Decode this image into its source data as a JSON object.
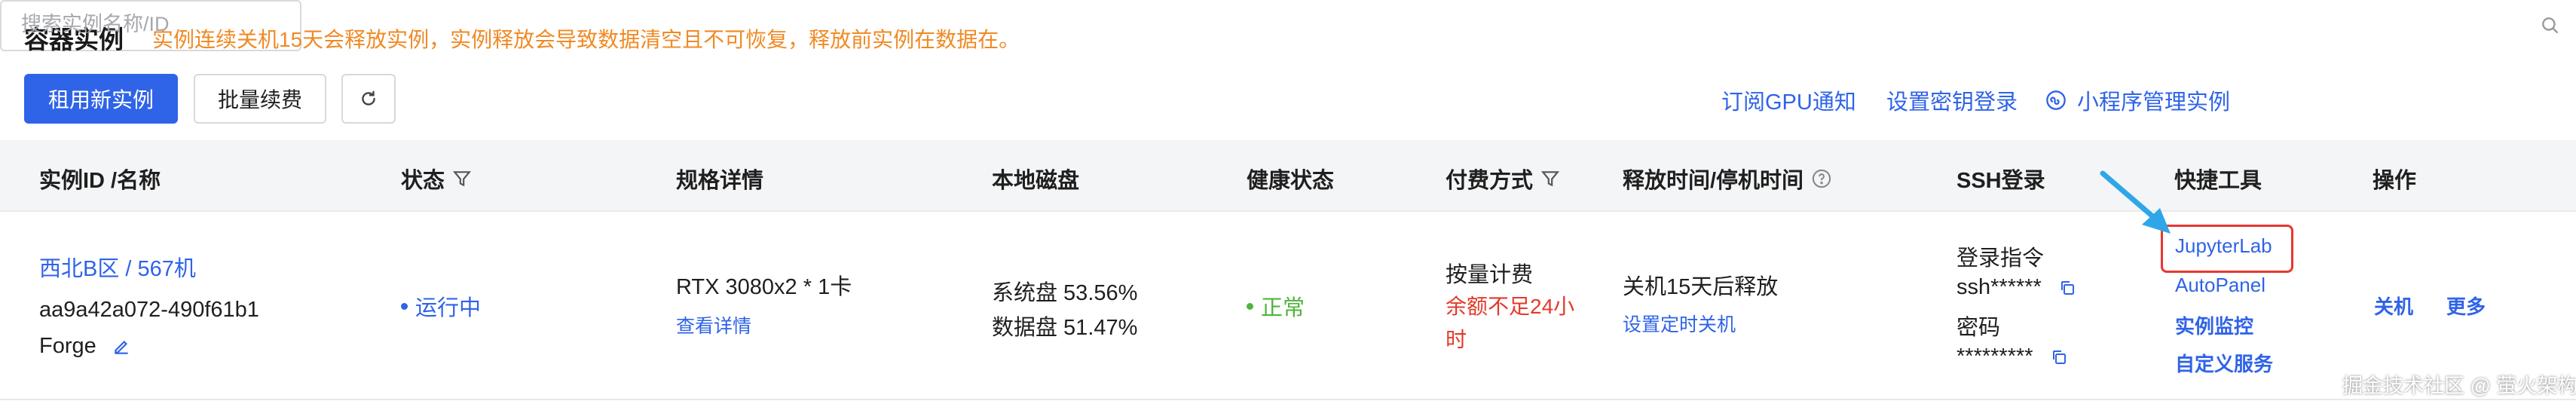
{
  "header": {
    "title": "容器实例",
    "notice": "实例连续关机15天会释放实例，实例释放会导致数据清空且不可恢复，释放前实例在数据在。"
  },
  "toolbar": {
    "new_instance": "租用新实例",
    "batch_renew": "批量续费",
    "subscribe_gpu": "订阅GPU通知",
    "set_key_login": "设置密钥登录",
    "miniprogram_manage": "小程序管理实例",
    "search_placeholder": "搜索实例名称/ID"
  },
  "table": {
    "columns": [
      "实例ID /名称",
      "状态",
      "规格详情",
      "本地磁盘",
      "健康状态",
      "付费方式",
      "释放时间/停机时间",
      "SSH登录",
      "快捷工具",
      "操作"
    ],
    "rows": [
      {
        "region_name": "西北B区 / 567机",
        "instance_id": "aa9a42a072-490f61b1",
        "image": "Forge",
        "status": "运行中",
        "spec": "RTX 3080x2 * 1卡",
        "spec_detail_link": "查看详情",
        "disk_system": "系统盘 53.56%",
        "disk_data": "数据盘 51.47%",
        "health": "正常",
        "billing": "按量计费",
        "billing_warning_line1": "余额不足24小",
        "billing_warning_line2": "时",
        "release": "关机15天后释放",
        "release_link": "设置定时关机",
        "ssh_cmd_label": "登录指令",
        "ssh_cmd": "ssh******",
        "ssh_pwd_label": "密码",
        "ssh_pwd": "*********",
        "tools": [
          "JupyterLab",
          "AutoPanel",
          "实例监控",
          "自定义服务"
        ],
        "actions": [
          "关机",
          "更多"
        ]
      }
    ]
  },
  "watermark": "掘金技术社区 @ 萤火架构",
  "colors": {
    "primary": "#2f63e8",
    "warning": "#f08a24",
    "danger": "#e33a2a",
    "success": "#4fb43c",
    "highlight_box": "#e8372f",
    "arrow": "#2fa6e8"
  }
}
